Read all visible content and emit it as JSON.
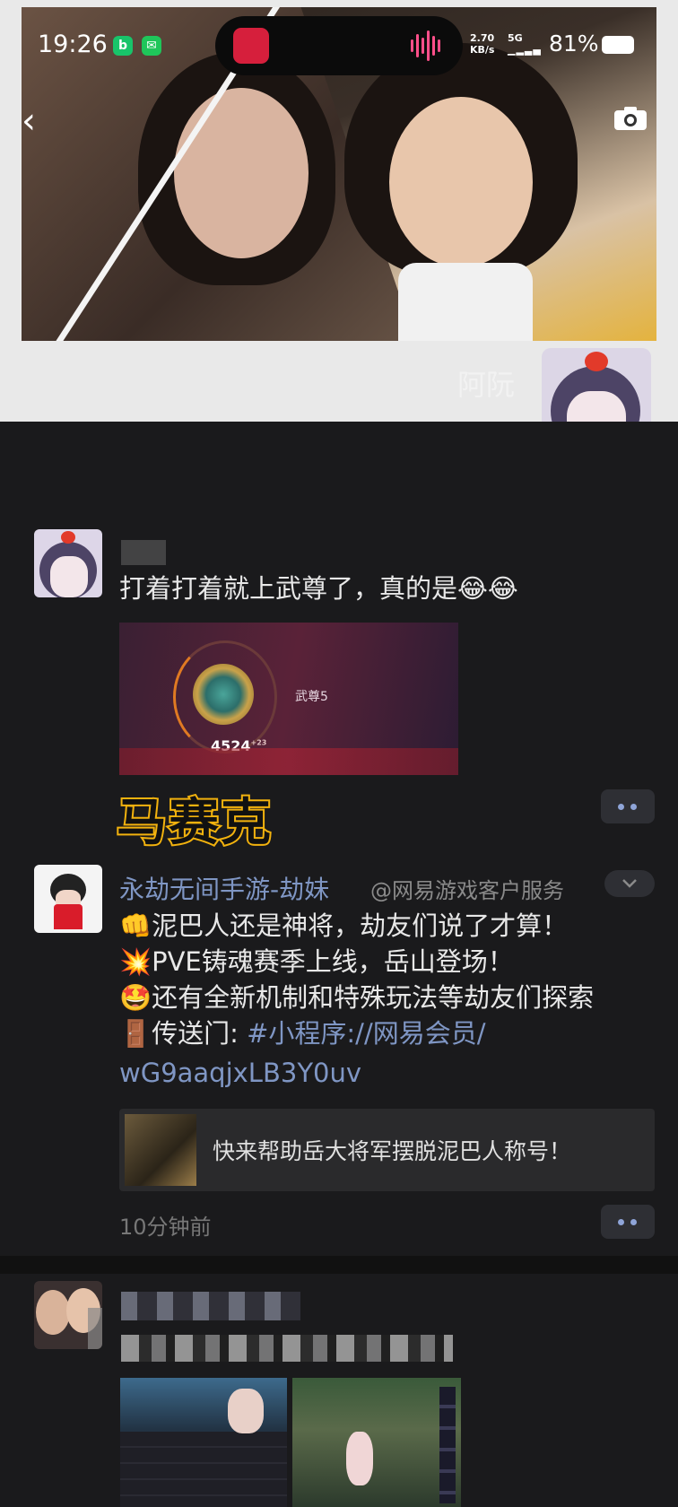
{
  "status_bar": {
    "time": "19:26",
    "net_speed_value": "2.70",
    "net_speed_unit": "KB/s",
    "network": "5G",
    "battery": "81%"
  },
  "cover": {
    "owner_name": "阿阮"
  },
  "posts": [
    {
      "text": "打着打着就上武尊了，真的是😂😂",
      "rank_title": "武尊5",
      "rank_score": "4524",
      "rank_delta": "+23",
      "overlay_caption": "马赛克"
    },
    {
      "author": "永劫无间手游-劫妹",
      "source": "@网易游戏客户服务",
      "lines": [
        "👊泥巴人还是神将，劫友们说了才算！",
        "💥PVE铸魂赛季上线，岳山登场！",
        "🤩还有全新机制和特殊玩法等劫友们探索",
        "🚪传送门: "
      ],
      "link_line1": "#小程序://网易会员/",
      "link_line2": "wG9aaqjxLB3Y0uv",
      "share_title": "快来帮助岳大将军摆脱泥巴人称号！",
      "time_ago": "10分钟前"
    }
  ],
  "colors": {
    "feed_bg": "#1a1a1c",
    "link": "#7f96c4",
    "caption_stroke": "#f2b20e"
  }
}
